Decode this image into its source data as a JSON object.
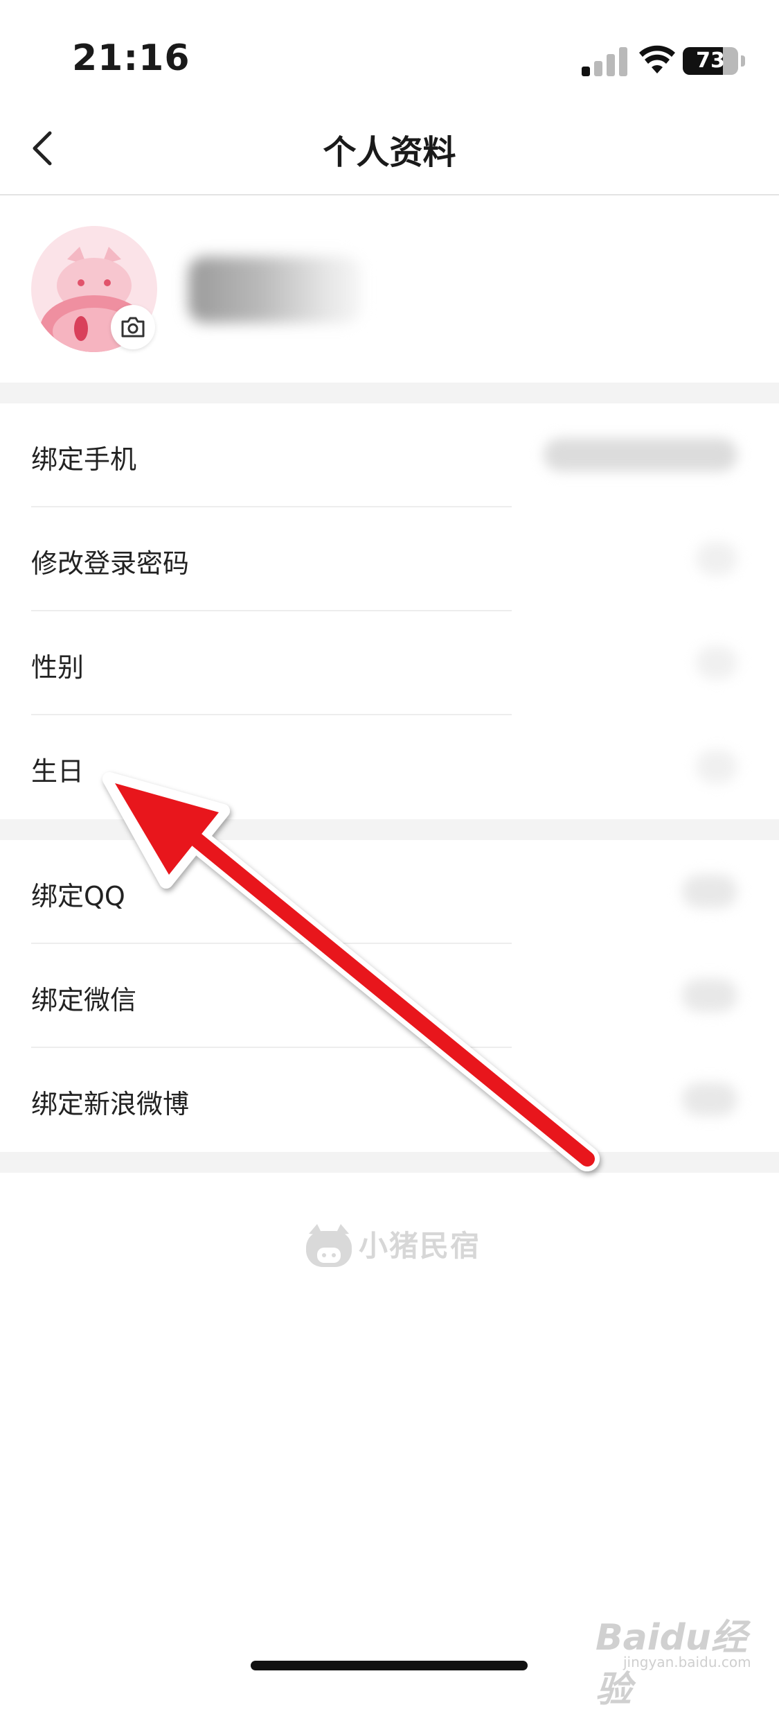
{
  "status_bar": {
    "time": "21:16",
    "battery": "73",
    "battery_level": 0.73,
    "signal_icon": "cellular-signal-icon",
    "wifi_icon": "wifi-icon",
    "battery_icon": "battery-icon"
  },
  "header": {
    "title": "个人资料",
    "back_icon": "chevron-left-icon"
  },
  "profile": {
    "avatar_icon": "pig-avatar",
    "camera_icon": "camera-icon"
  },
  "section1": {
    "items": [
      {
        "label": "绑定手机"
      },
      {
        "label": "修改登录密码"
      },
      {
        "label": "性别"
      },
      {
        "label": "生日"
      }
    ]
  },
  "section2": {
    "items": [
      {
        "label": "绑定QQ"
      },
      {
        "label": "绑定微信"
      },
      {
        "label": "绑定新浪微博"
      }
    ]
  },
  "footer": {
    "logo_text": "小猪民宿",
    "logo_icon": "pig-logo-icon"
  },
  "watermark": {
    "main": "Baidu经验",
    "sub": "jingyan.baidu.com"
  },
  "annotation": {
    "arrow_color": "#e8141b",
    "arrow_icon": "red-arrow-annotation"
  }
}
